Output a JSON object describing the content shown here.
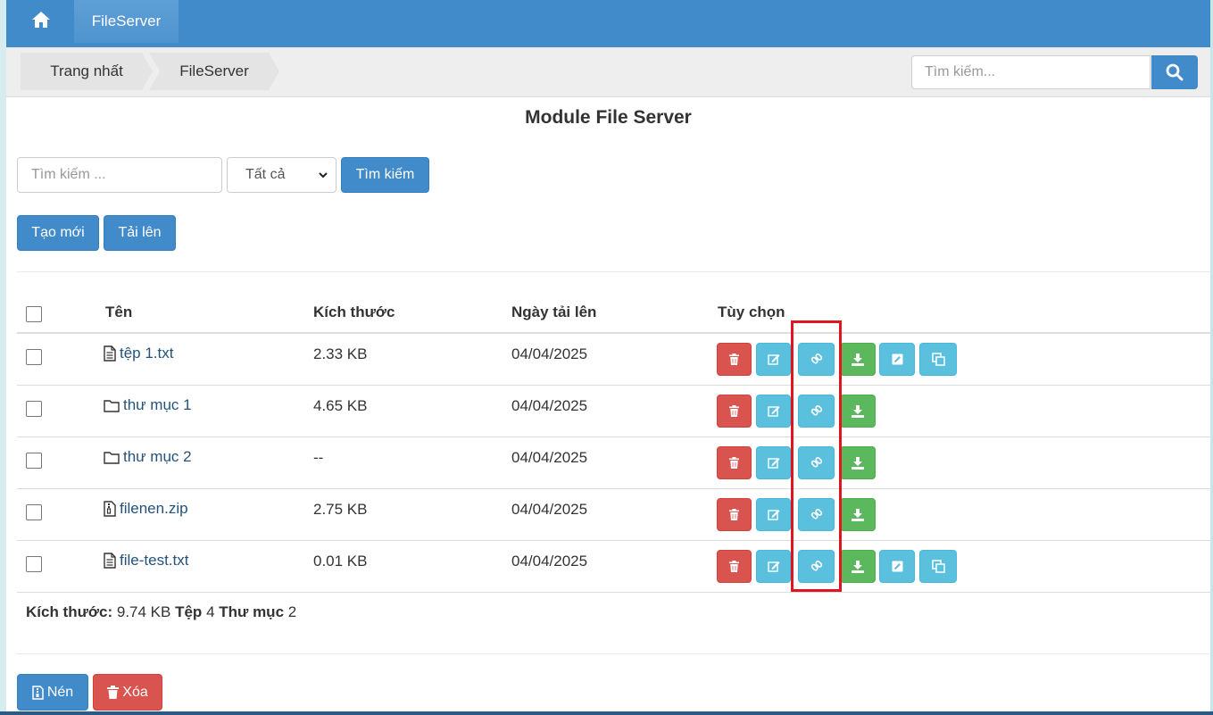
{
  "colors": {
    "primary": "#428bca",
    "danger": "#d9534f",
    "info": "#5bc0de",
    "success": "#5cb85c",
    "highlight": "#e0151f"
  },
  "nav": {
    "home_icon": "home-icon",
    "tab_label": "FileServer"
  },
  "breadcrumb": {
    "items": [
      {
        "label": "Trang nhất"
      },
      {
        "label": "FileServer"
      }
    ]
  },
  "top_search": {
    "placeholder": "Tìm kiếm...",
    "icon": "search-icon"
  },
  "page_title": "Module File Server",
  "filter": {
    "placeholder": "Tìm kiếm ...",
    "select_value": "Tất cả",
    "search_button": "Tìm kiếm"
  },
  "actions": {
    "create_label": "Tạo mới",
    "upload_label": "Tải lên"
  },
  "table": {
    "headers": {
      "name": "Tên",
      "size": "Kích thước",
      "date": "Ngày tải lên",
      "options": "Tùy chọn"
    },
    "rows": [
      {
        "name": "tệp 1.txt",
        "type": "file-text",
        "size": "2.33 KB",
        "date": "04/04/2025",
        "buttons": [
          "delete",
          "edit",
          "link",
          "download",
          "text-edit",
          "copy"
        ]
      },
      {
        "name": "thư mục 1",
        "type": "folder",
        "size": "4.65 KB",
        "date": "04/04/2025",
        "buttons": [
          "delete",
          "edit",
          "link",
          "download"
        ]
      },
      {
        "name": "thư mục 2",
        "type": "folder",
        "size": "--",
        "date": "04/04/2025",
        "buttons": [
          "delete",
          "edit",
          "link",
          "download"
        ]
      },
      {
        "name": "filenen.zip",
        "type": "file-zip",
        "size": "2.75 KB",
        "date": "04/04/2025",
        "buttons": [
          "delete",
          "edit",
          "link",
          "download"
        ]
      },
      {
        "name": "file-test.txt",
        "type": "file-text",
        "size": "0.01 KB",
        "date": "04/04/2025",
        "buttons": [
          "delete",
          "edit",
          "link",
          "download",
          "text-edit",
          "copy"
        ]
      }
    ]
  },
  "summary": {
    "size_label": "Kích thước:",
    "size_value": "9.74 KB",
    "files_label": "Tệp",
    "files_value": "4",
    "folders_label": "Thư mục",
    "folders_value": "2"
  },
  "bottom": {
    "compress_label": "Nén",
    "delete_label": "Xóa"
  }
}
